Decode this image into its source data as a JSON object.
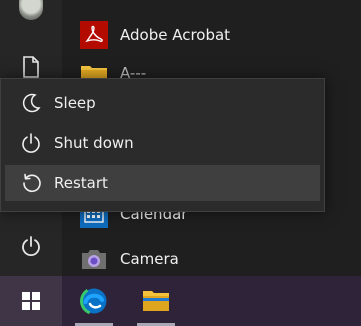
{
  "start_menu": {
    "apps": [
      {
        "label": "Adobe Acrobat",
        "icon": "adobe-acrobat-icon",
        "color": "#b30b00"
      },
      {
        "label": "A---",
        "icon": "folder-icon",
        "color": "#f5c542"
      },
      {
        "label": "Calendar",
        "icon": "calendar-icon",
        "color": "#0f6cbd"
      },
      {
        "label": "Camera",
        "icon": "camera-icon",
        "color": "#6b6b6b"
      }
    ],
    "power_menu": {
      "items": [
        {
          "label": "Sleep",
          "icon": "sleep-moon-icon"
        },
        {
          "label": "Shut down",
          "icon": "power-icon"
        },
        {
          "label": "Restart",
          "icon": "restart-icon",
          "highlighted": true
        }
      ]
    },
    "rail": {
      "icons": [
        "user-avatar-icon",
        "document-icon",
        "power-icon"
      ]
    }
  },
  "taskbar": {
    "items": [
      {
        "name": "start-button",
        "icon": "windows-logo-icon"
      },
      {
        "name": "edge-button",
        "icon": "microsoft-edge-icon"
      },
      {
        "name": "file-explorer-button",
        "icon": "folder-icon"
      }
    ]
  }
}
